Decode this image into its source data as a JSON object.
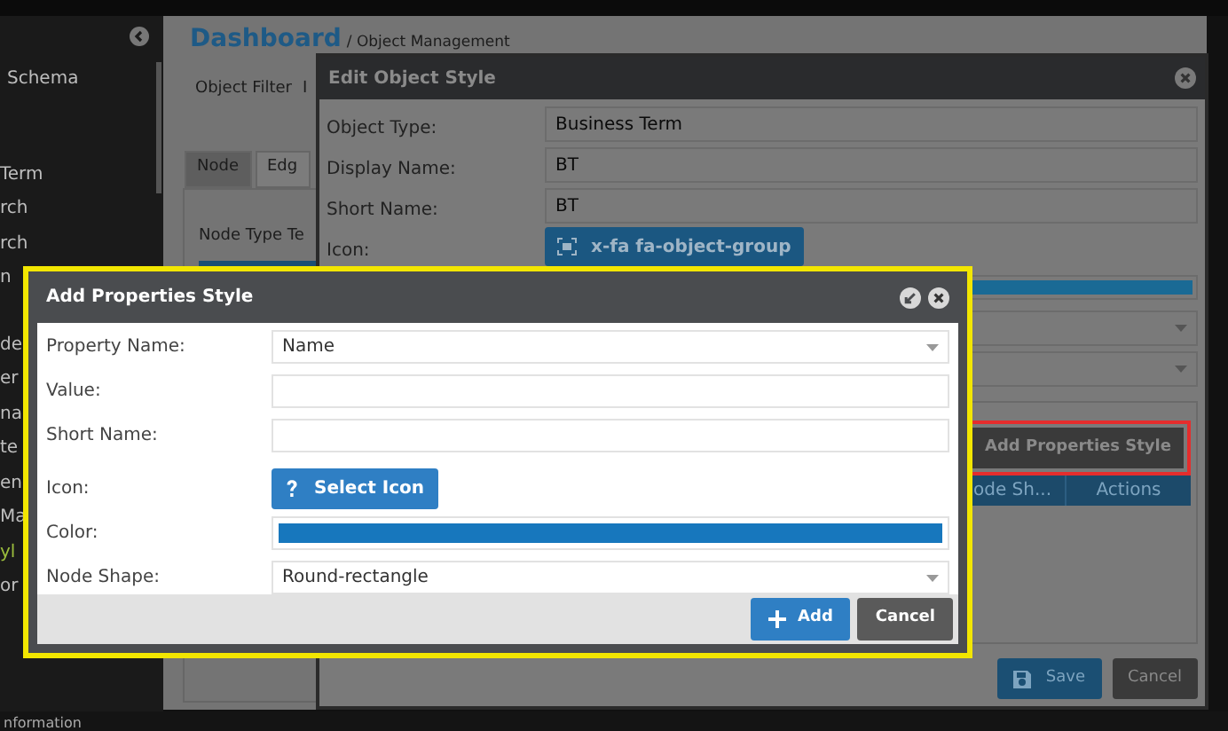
{
  "sidebar": {
    "groups": [
      [
        {
          "label": "Schema",
          "selected": false
        }
      ],
      [
        {
          "label": "Term",
          "selected": false
        },
        {
          "label": "rch",
          "selected": false
        },
        {
          "label": "rch",
          "selected": false
        },
        {
          "label": "n",
          "selected": false
        }
      ],
      [
        {
          "label": "de",
          "selected": false
        },
        {
          "label": "er",
          "selected": false
        },
        {
          "label": "na",
          "selected": false
        },
        {
          "label": "te",
          "selected": false
        },
        {
          "label": "en",
          "selected": false
        },
        {
          "label": "Ma",
          "selected": false
        },
        {
          "label": "yl",
          "selected": true
        },
        {
          "label": "or",
          "selected": false
        }
      ]
    ]
  },
  "page": {
    "title": "Dashboard",
    "breadcrumb": "/ Object Management",
    "toolbar": [
      "Object Filter",
      "I"
    ],
    "tabs": [
      {
        "label": "Node",
        "selected": true
      },
      {
        "label": "Edg",
        "selected": false
      }
    ],
    "section_label": "Node Type Te"
  },
  "edit_dialog": {
    "title": "Edit Object Style",
    "fields": [
      {
        "kind": "text",
        "label": "Object Type:",
        "value": "Business Term"
      },
      {
        "kind": "text",
        "label": "Display Name:",
        "value": "BT"
      },
      {
        "kind": "text",
        "label": "Short Name:",
        "value": "BT"
      },
      {
        "kind": "icon",
        "label": "Icon:",
        "value": "x-fa fa-object-group"
      },
      {
        "kind": "color",
        "color": "#1a6a95"
      },
      {
        "kind": "select"
      },
      {
        "kind": "select"
      }
    ],
    "add_button": "Add Properties Style",
    "table": {
      "columns": [
        "ode Sh...",
        "Actions"
      ]
    },
    "buttons": [
      {
        "kind": "primary",
        "label": "Save"
      },
      {
        "kind": "secondary",
        "label": "Cancel"
      }
    ]
  },
  "add_dialog": {
    "title": "Add Properties Style",
    "fields": [
      {
        "kind": "select",
        "label": "Property Name:",
        "value": "Name"
      },
      {
        "kind": "text",
        "label": "Value:"
      },
      {
        "kind": "text",
        "label": "Short Name:"
      },
      {
        "kind": "icon",
        "label": "Icon:",
        "value": "Select Icon"
      },
      {
        "kind": "color",
        "label": "Color:",
        "color": "#1777bd"
      },
      {
        "kind": "select",
        "label": "Node Shape:",
        "value": "Round-rectangle"
      }
    ],
    "buttons": [
      {
        "kind": "primary",
        "label": "Add"
      },
      {
        "kind": "secondary",
        "label": "Cancel"
      }
    ]
  },
  "status_bar": {
    "text": "nformation"
  }
}
